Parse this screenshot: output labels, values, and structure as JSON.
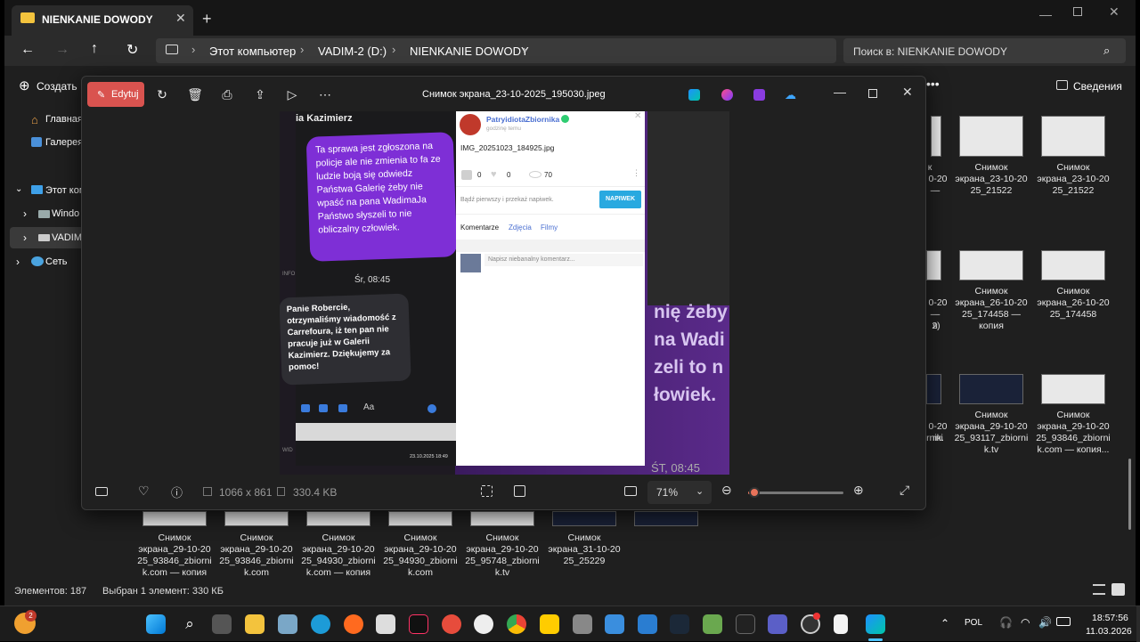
{
  "explorer": {
    "tab_title": "NIENKANIE DOWODY",
    "breadcrumbs": [
      "Этот компьютер",
      "VADIM-2 (D:)",
      "NIENKANIE DOWODY"
    ],
    "search_placeholder": "Поиск в: NIENKANIE DOWODY",
    "create_label": "Создать",
    "details_label": "Сведения",
    "sidebar": {
      "home": "Главная",
      "gallery": "Галерея",
      "this_pc": "Этот ком",
      "windows": "Windo",
      "vadim": "VADIM-",
      "network": "Сеть"
    },
    "tiles_right": [
      [
        "Снимок",
        "экрана_23-10-20",
        "25_21522"
      ],
      [
        "Снимок",
        "экрана_23-10-20",
        "25_21522"
      ],
      [
        "Снимок",
        "экрана_26-10-20",
        "25_174458 —",
        "копия"
      ],
      [
        "Снимок",
        "экрана_26-10-20",
        "25_174458"
      ],
      [
        "Снимок",
        "экрана_29-10-20",
        "25_93117_zbiorni",
        "k.tv"
      ],
      [
        "Снимок",
        "экрана_29-10-20",
        "25_93846_zbiorni",
        "k.com — копия..."
      ]
    ],
    "partial_right_labels": [
      "к",
      "0-20",
      "—",
      "0-20",
      "—",
      "я",
      "2)",
      "0-20",
      "rni",
      "rnik."
    ],
    "tiles_bottom": [
      [
        "Снимок",
        "экрана_29-10-20",
        "25_93846_zbiorni",
        "k.com — копия"
      ],
      [
        "Снимок",
        "экрана_29-10-20",
        "25_93846_zbiorni",
        "k.com"
      ],
      [
        "Снимок",
        "экрана_29-10-20",
        "25_94930_zbiorni",
        "k.com — копия"
      ],
      [
        "Снимок",
        "экрана_29-10-20",
        "25_94930_zbiorni",
        "k.com"
      ],
      [
        "Снимок",
        "экрана_29-10-20",
        "25_95748_zbiorni",
        "k.tv"
      ],
      [
        "Снимок",
        "экрана_31-10-20",
        "25_25229"
      ]
    ],
    "status_items": "Элементов: 187",
    "status_selected": "Выбран 1 элемент: 330 КБ"
  },
  "viewer": {
    "edit_label": "Edytuj",
    "filename": "Снимок экрана_23-10-2025_195030.jpeg",
    "dimensions": "1066 x 861",
    "filesize": "330.4 KB",
    "zoom": "71%",
    "zoom_level_percent": 7
  },
  "photo": {
    "chat_header": "ia Kazimierz",
    "bubble1": "Ta sprawa jest zgłoszona na policje ale nie zmienia to fa ze ludzie boją się odwiedz Państwa Galerię żeby nie wpaść na pana WadimaJa Państwo słyszeli to nie obliczalny człowiek.",
    "time": "Śr, 08:45",
    "bubble2": "Panie Robercie, otrzymaliśmy wiadomość z Carrefoura, iż ten pan nie pracuje już w Galerii Kazimierz. Dziękujemy za pomoc!",
    "input_text": "Aa",
    "photo_stamp": "23.10.2025 18:49",
    "bg_text": [
      "nię żeby",
      "na Wadi",
      "zeli to n",
      "łowiek."
    ],
    "bg_time": "ŚT, 08:45",
    "side_labels": [
      "INFO",
      "WID"
    ]
  },
  "panel": {
    "username": "PatryidiotaZbiornika",
    "subtitle": "godzinę temu",
    "filename": "IMG_20251023_184925.jpg",
    "likes": "0",
    "hearts": "0",
    "views": "70",
    "tip_text": "Bądź pierwszy i przekaż napiwek.",
    "tip_button": "NAPIWEK",
    "tabs": [
      "Komentarze",
      "Zdjęcia",
      "Filmy"
    ],
    "comment_placeholder": "Napisz niebanalny komentarz..."
  },
  "taskbar": {
    "notification_badge": "2",
    "language": "POL",
    "time": "18:57:56",
    "date": "11.03.2026"
  }
}
